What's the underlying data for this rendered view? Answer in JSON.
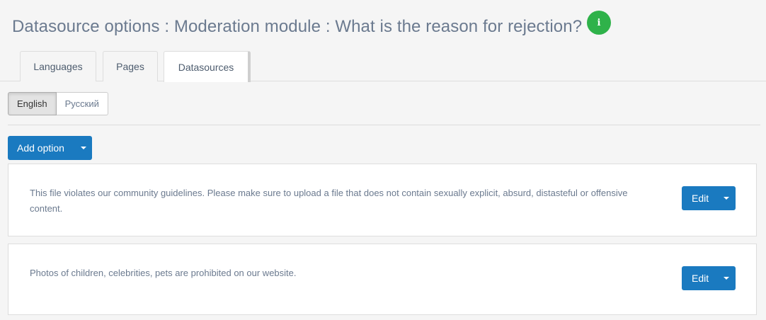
{
  "header": {
    "title": "Datasource options : Moderation module : What is the reason for rejection?",
    "info_icon": "i",
    "info_icon_name": "info-icon",
    "info_color": "#2fb24a"
  },
  "tabs": [
    {
      "label": "Languages",
      "active": false
    },
    {
      "label": "Pages",
      "active": false
    },
    {
      "label": "Datasources",
      "active": true
    }
  ],
  "languages": {
    "options": [
      {
        "label": "English",
        "selected": true
      },
      {
        "label": "Русский",
        "selected": false
      }
    ]
  },
  "toolbar": {
    "add_option_label": "Add option",
    "accent": "#1a7ac0"
  },
  "options": [
    {
      "text": "This file violates our community guidelines. Please make sure to upload a file that does not contain sexually explicit, absurd, distasteful or offensive content.",
      "edit_label": "Edit"
    },
    {
      "text": "Photos of children, celebrities, pets are prohibited on our website.",
      "edit_label": "Edit"
    }
  ]
}
